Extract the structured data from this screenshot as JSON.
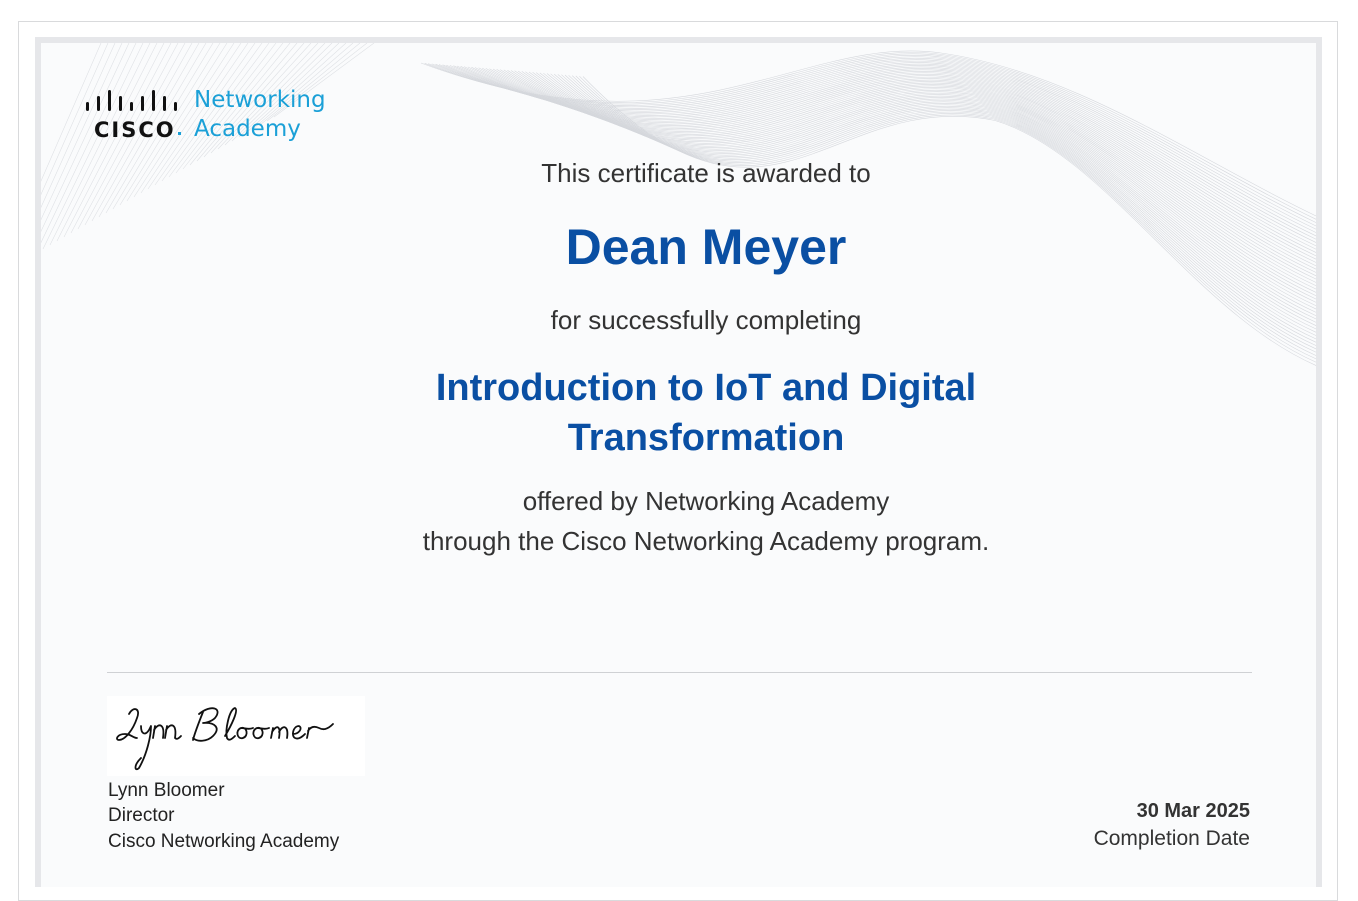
{
  "logo": {
    "brand": "CISCO",
    "program_line1": "Networking",
    "program_line2": "Academy"
  },
  "certificate": {
    "awarded_text": "This certificate is awarded to",
    "recipient_name": "Dean Meyer",
    "completing_text": "for successfully completing",
    "course_title": "Introduction to IoT and Digital Transformation",
    "offered_by": "offered by Networking Academy",
    "through_text": "through the Cisco Networking Academy program."
  },
  "signature": {
    "handwritten": "Lynn Bloomer",
    "name": "Lynn Bloomer",
    "title": "Director",
    "organization": "Cisco Networking Academy"
  },
  "completion": {
    "date": "30 Mar 2025",
    "label": "Completion Date"
  },
  "colors": {
    "accent_blue": "#0a4fa3",
    "cisco_cyan": "#1ba0d7"
  }
}
